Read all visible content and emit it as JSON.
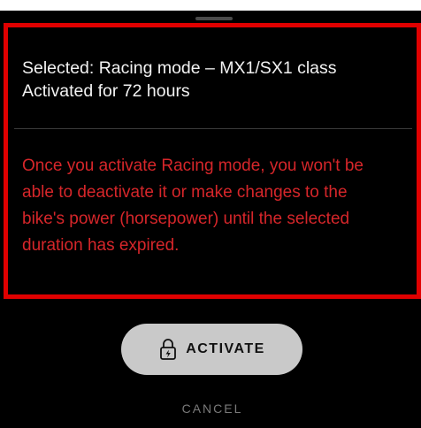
{
  "info": {
    "selected_line": "Selected: Racing mode – MX1/SX1 class",
    "duration_line": "Activated for 72 hours"
  },
  "warning": {
    "text": "Once you activate Racing mode, you won't be able to deactivate it or make changes to the bike's power (horsepower) until the selected duration has expired."
  },
  "actions": {
    "activate_label": "ACTIVATE",
    "activate_icon": "lock-charge-icon",
    "cancel_label": "CANCEL"
  },
  "colors": {
    "background": "#000000",
    "highlight_border": "#e00000",
    "warning_text": "#d6262a",
    "button_background": "#c9c9c9"
  }
}
